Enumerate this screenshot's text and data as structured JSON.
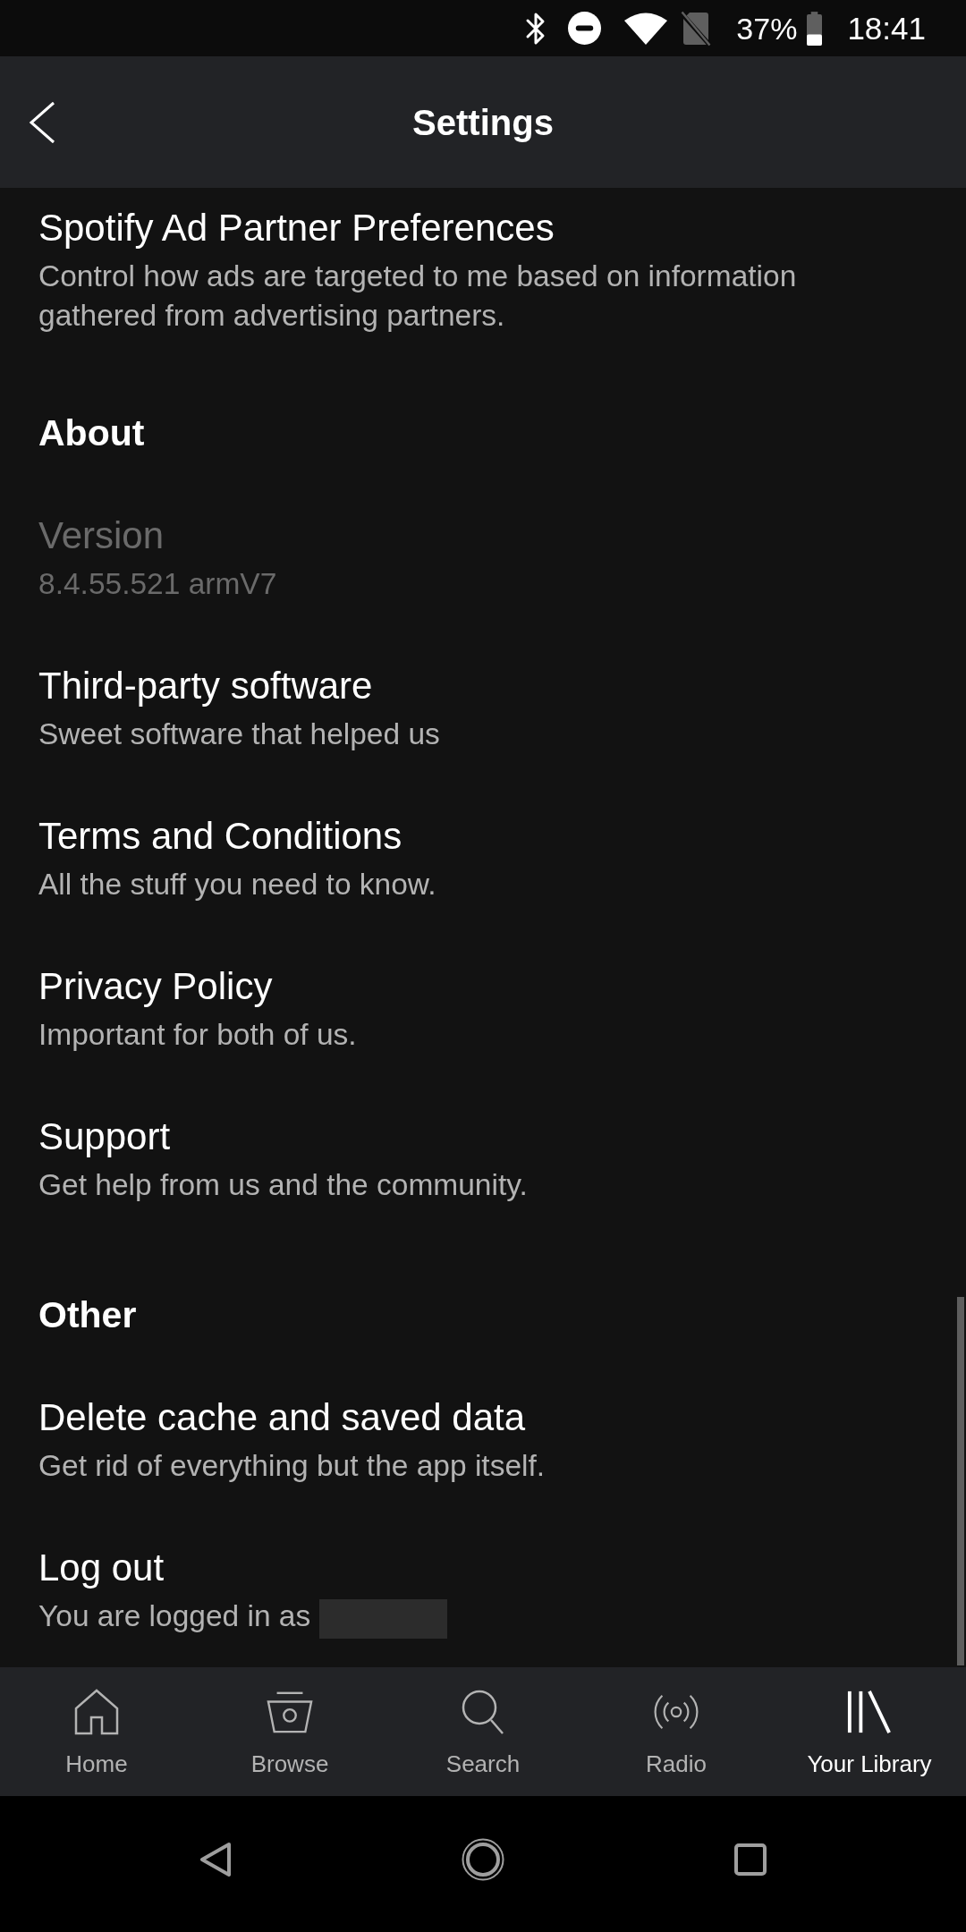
{
  "status_bar": {
    "battery_text": "37%",
    "time": "18:41"
  },
  "header": {
    "title": "Settings"
  },
  "sections": [
    {
      "items": [
        {
          "title": "Spotify Ad Partner Preferences",
          "subtitle": "Control how ads are targeted to me based on information gathered from advertising partners.",
          "disabled": false,
          "redacted": false
        }
      ]
    },
    {
      "heading": "About",
      "items": [
        {
          "title": "Version",
          "subtitle": "8.4.55.521 armV7",
          "disabled": true,
          "redacted": false
        },
        {
          "title": "Third-party software",
          "subtitle": "Sweet software that helped us",
          "disabled": false,
          "redacted": false
        },
        {
          "title": "Terms and Conditions",
          "subtitle": "All the stuff you need to know.",
          "disabled": false,
          "redacted": false
        },
        {
          "title": "Privacy Policy",
          "subtitle": "Important for both of us.",
          "disabled": false,
          "redacted": false
        },
        {
          "title": "Support",
          "subtitle": "Get help from us and the community.",
          "disabled": false,
          "redacted": false
        }
      ]
    },
    {
      "heading": "Other",
      "items": [
        {
          "title": "Delete cache and saved data",
          "subtitle": "Get rid of everything but the app itself.",
          "disabled": false,
          "redacted": false
        },
        {
          "title": "Log out",
          "subtitle": "You are logged in as",
          "disabled": false,
          "redacted": true
        }
      ]
    }
  ],
  "bottom_nav": [
    {
      "label": "Home",
      "selected": false
    },
    {
      "label": "Browse",
      "selected": false
    },
    {
      "label": "Search",
      "selected": false
    },
    {
      "label": "Radio",
      "selected": false
    },
    {
      "label": "Your Library",
      "selected": true
    }
  ]
}
